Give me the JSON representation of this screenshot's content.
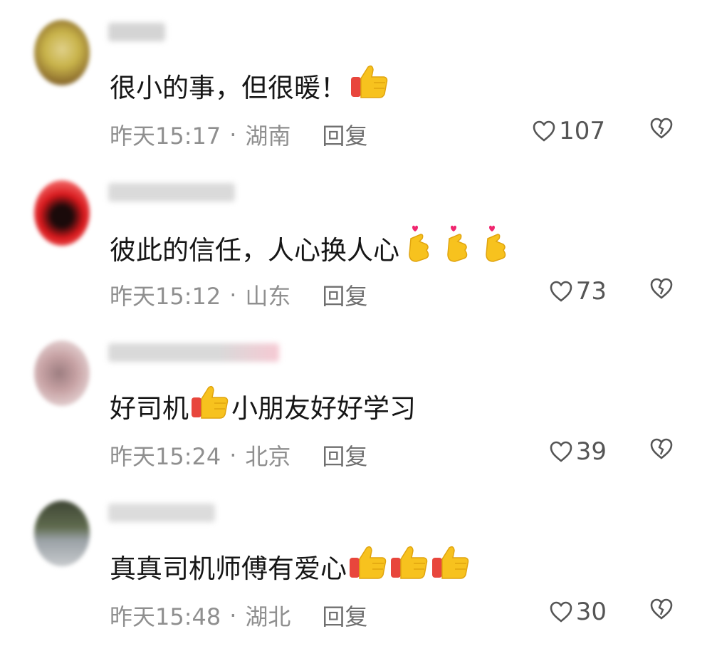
{
  "comments": [
    {
      "text": "很小的事，但很暖！",
      "emoji": [
        "thumbs-up"
      ],
      "time": "昨天15:17",
      "location": "湖南",
      "reply_label": "回复",
      "likes": "107",
      "avatar_colors": [
        "#c8b34a",
        "#8a6a2c",
        "#e0d08a"
      ]
    },
    {
      "text": "彼此的信任，人心换人心",
      "emoji": [
        "heart-hands",
        "heart-hands",
        "heart-hands"
      ],
      "time": "昨天15:12",
      "location": "山东",
      "reply_label": "回复",
      "likes": "73",
      "avatar_colors": [
        "#d8181c",
        "#1a0a0a",
        "#f06060"
      ]
    },
    {
      "text_before": "好司机",
      "emoji": [
        "thumbs-up"
      ],
      "text_after": "小朋友好好学习",
      "time": "昨天15:24",
      "location": "北京",
      "reply_label": "回复",
      "likes": "39",
      "avatar_colors": [
        "#c7a2a4",
        "#e3cfd0",
        "#9c7d80"
      ]
    },
    {
      "text": "真真司机师傅有爱心",
      "emoji": [
        "thumbs-up",
        "thumbs-up",
        "thumbs-up"
      ],
      "time": "昨天15:48",
      "location": "湖北",
      "reply_label": "回复",
      "likes": "30",
      "avatar_colors": [
        "#5f6b4e",
        "#9aa1a6",
        "#3e4534"
      ]
    }
  ],
  "colors": {
    "text": "#161616",
    "meta": "#8f8f8f",
    "icon": "#555555",
    "thumb_yellow": "#f7c21e",
    "cuff_red": "#e8463c",
    "heart_pink": "#f0266f"
  },
  "icons": {
    "like": "heart-outline-icon",
    "dislike": "broken-heart-icon"
  }
}
